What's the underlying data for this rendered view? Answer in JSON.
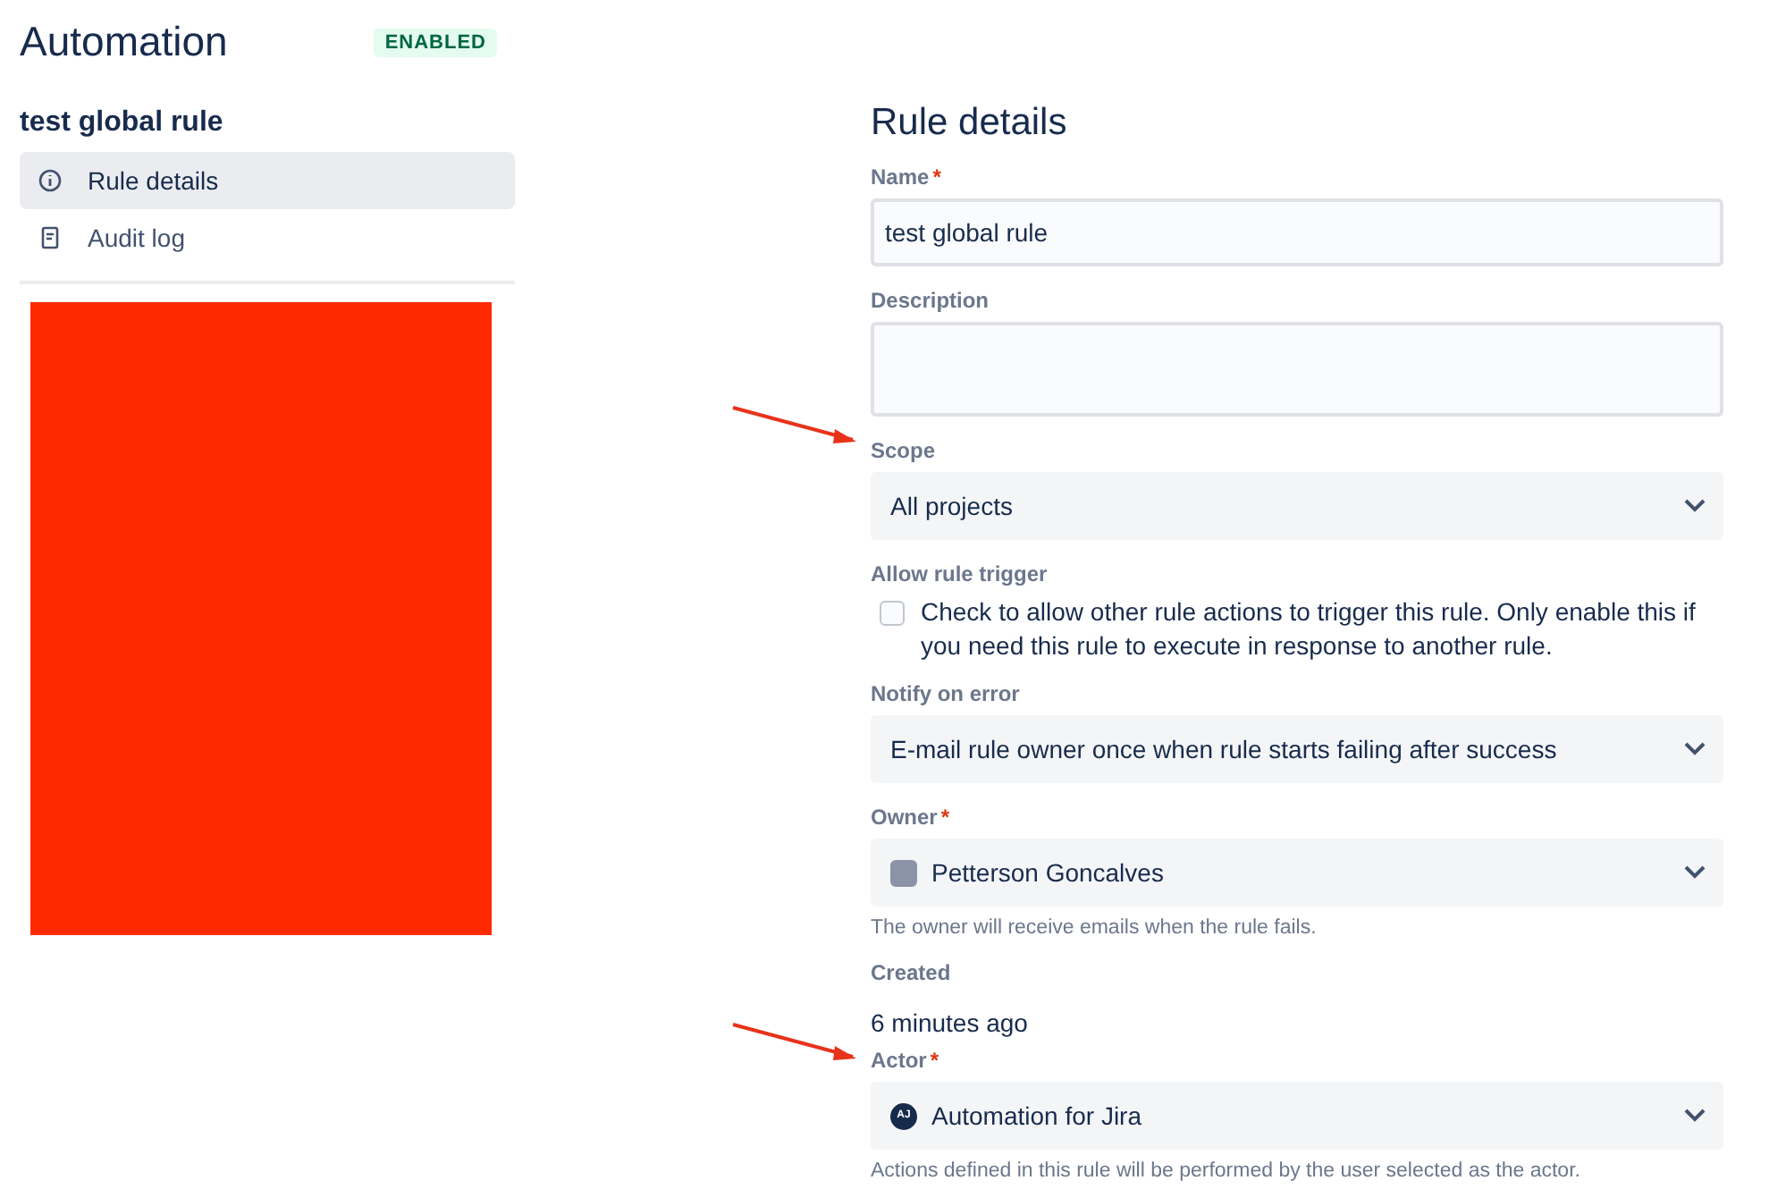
{
  "header": {
    "title": "Automation",
    "status_badge": "ENABLED"
  },
  "sidebar": {
    "rule_name": "test global rule",
    "items": [
      {
        "label": "Rule details",
        "selected": true
      },
      {
        "label": "Audit log",
        "selected": false
      }
    ]
  },
  "form": {
    "title": "Rule details",
    "fields": [
      {
        "kind": "text",
        "label": "Name",
        "required_mark": "*",
        "value": "test global rule"
      },
      {
        "kind": "textarea",
        "label": "Description"
      },
      {
        "kind": "select",
        "label": "Scope",
        "value": "All projects",
        "arrow": true
      },
      {
        "kind": "checkbox",
        "label": "Allow rule trigger",
        "text": "Check to allow other rule actions to trigger this rule. Only enable this if you need this rule to execute in response to another rule.",
        "checked": false
      },
      {
        "kind": "select",
        "label": "Notify on error",
        "value": "E-mail rule owner once when rule starts failing after success"
      },
      {
        "kind": "user_select",
        "label": "Owner",
        "required_mark": "*",
        "value": "Petterson Goncalves",
        "help": "The owner will receive emails when the rule fails."
      },
      {
        "kind": "static",
        "label": "Created",
        "value": "6 minutes ago"
      },
      {
        "kind": "user_select",
        "label": "Actor",
        "required_mark": "*",
        "value": "Automation for Jira",
        "avatar_text": "AJ",
        "arrow": true,
        "help": "Actions defined in this rule will be performed by the user selected as the actor."
      }
    ]
  }
}
